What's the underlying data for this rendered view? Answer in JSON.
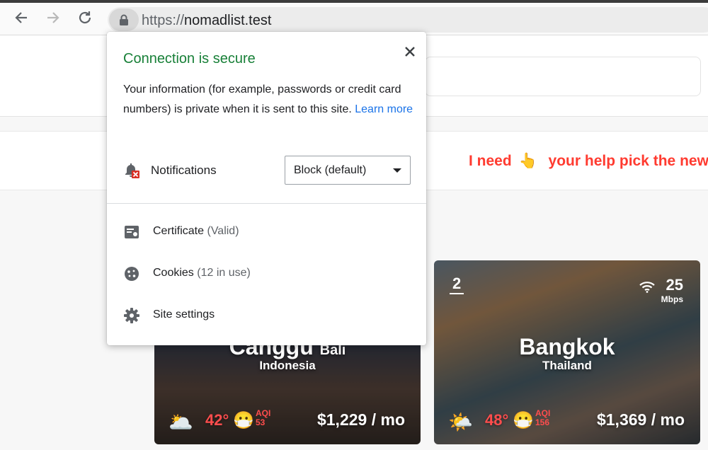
{
  "browser": {
    "url_scheme": "https://",
    "url_host": "nomadlist.test",
    "back_icon": "arrow-left-icon",
    "forward_icon": "arrow-right-icon",
    "reload_icon": "reload-icon",
    "lock_icon": "lock-icon"
  },
  "popup": {
    "title": "Connection is secure",
    "description": "Your information (for example, passwords or credit card numbers) is private when it is sent to this site.",
    "learn_more": "Learn more",
    "notifications_label": "Notifications",
    "notifications_value": "Block (default)",
    "items": [
      {
        "label": "Certificate",
        "sub": "(Valid)",
        "icon": "certificate-icon"
      },
      {
        "label": "Cookies",
        "sub": "(12 in use)",
        "icon": "cookie-icon"
      },
      {
        "label": "Site settings",
        "sub": "",
        "icon": "gear-icon"
      }
    ],
    "title_color": "#188038",
    "link_color": "#1a73e8"
  },
  "banner": {
    "text_before": "I need",
    "emoji": "👆",
    "text_after": "your help pick the new"
  },
  "cards": [
    {
      "city": "Canggu",
      "region": "Bali",
      "country": "Indonesia",
      "weather_emoji": "🌥️",
      "temperature": "42°",
      "mask_emoji": "😷",
      "aqi_label": "AQI",
      "aqi_value": "53",
      "price": "$1,229 / mo"
    },
    {
      "rank": "2",
      "city": "Bangkok",
      "country": "Thailand",
      "wifi_speed": "25",
      "wifi_unit": "Mbps",
      "weather_emoji": "🌤️",
      "temperature": "48°",
      "mask_emoji": "😷",
      "aqi_label": "AQI",
      "aqi_value": "156",
      "price": "$1,369 / mo"
    }
  ]
}
